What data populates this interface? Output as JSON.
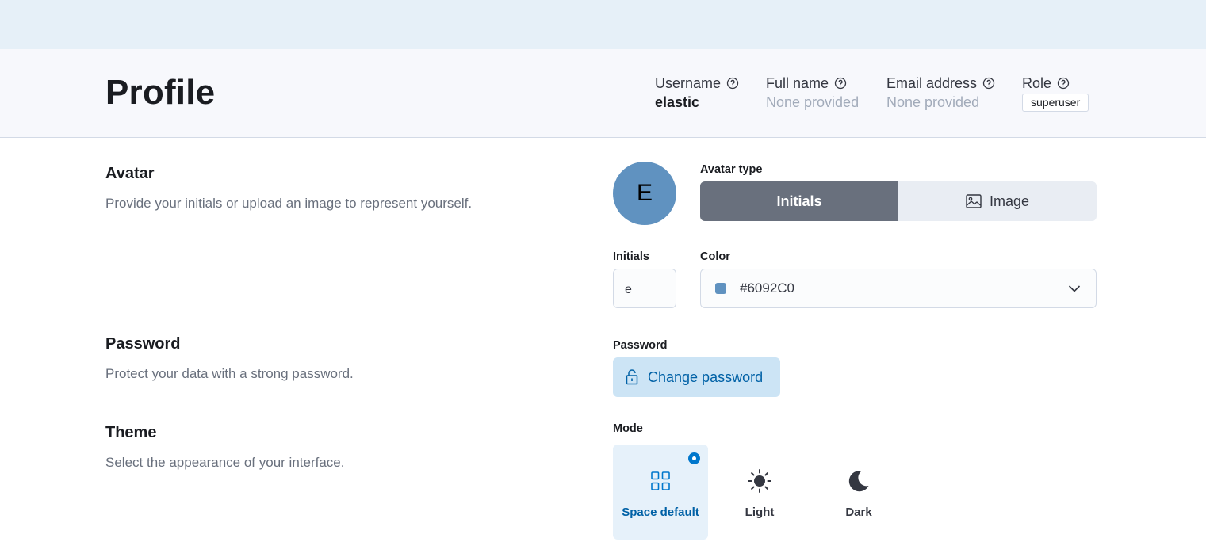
{
  "header": {
    "title": "Profile",
    "meta": [
      {
        "label": "Username",
        "value": "elastic"
      },
      {
        "label": "Full name",
        "value": "None provided"
      },
      {
        "label": "Email address",
        "value": "None provided"
      },
      {
        "label": "Role",
        "value": "superuser"
      }
    ]
  },
  "avatar": {
    "title": "Avatar",
    "description": "Provide your initials or upload an image to represent yourself.",
    "preview_letter": "E",
    "type_label": "Avatar type",
    "type_options": [
      "Initials",
      "Image"
    ],
    "selected_type": "Initials",
    "initials_label": "Initials",
    "initials_value": "e",
    "color_label": "Color",
    "color_value": "#6092C0"
  },
  "password": {
    "title": "Password",
    "description": "Protect your data with a strong password.",
    "field_label": "Password",
    "button_label": "Change password"
  },
  "theme": {
    "title": "Theme",
    "description": "Select the appearance of your interface.",
    "mode_label": "Mode",
    "modes": [
      {
        "label": "Space default",
        "icon": "grid-icon"
      },
      {
        "label": "Light",
        "icon": "sun-icon"
      },
      {
        "label": "Dark",
        "icon": "moon-icon"
      }
    ],
    "selected_mode": "Space default"
  },
  "colors": {
    "accent": "#0077cc",
    "avatar_bg": "#6092C0",
    "top_band": "#e6f0f8",
    "header_bg": "#f7f8fc"
  }
}
